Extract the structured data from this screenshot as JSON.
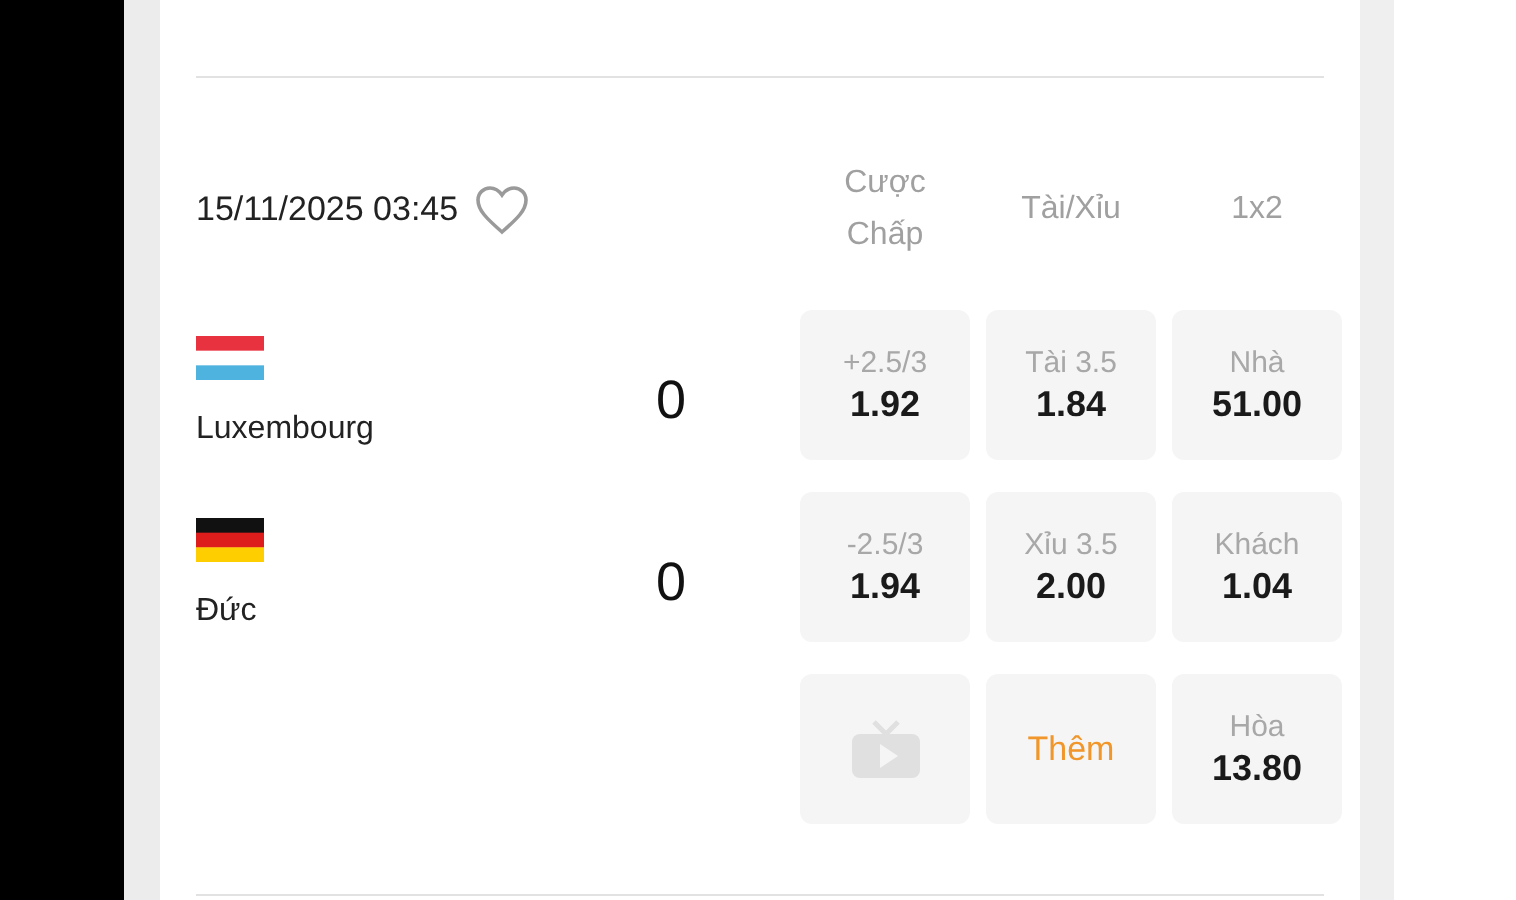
{
  "match": {
    "datetime": "15/11/2025 03:45",
    "favorite": false
  },
  "columns": [
    "Cược Chấp",
    "Tài/Xỉu",
    "1x2"
  ],
  "teams": [
    {
      "name": "Luxembourg",
      "score": "0",
      "kind": "luxembourg"
    },
    {
      "name": "Đức",
      "score": "0",
      "kind": "germany"
    }
  ],
  "odds_rows": [
    [
      {
        "kind": "odds",
        "label": "+2.5/3",
        "price": "1.92"
      },
      {
        "kind": "odds",
        "label": "Tài 3.5",
        "price": "1.84"
      },
      {
        "kind": "odds",
        "label": "Nhà",
        "price": "51.00"
      }
    ],
    [
      {
        "kind": "odds",
        "label": "-2.5/3",
        "price": "1.94"
      },
      {
        "kind": "odds",
        "label": "Xỉu 3.5",
        "price": "2.00"
      },
      {
        "kind": "odds",
        "label": "Khách",
        "price": "1.04"
      }
    ],
    [
      {
        "kind": "tv"
      },
      {
        "kind": "more",
        "label": "Thêm"
      },
      {
        "kind": "odds",
        "label": "Hòa",
        "price": "13.80"
      }
    ]
  ]
}
